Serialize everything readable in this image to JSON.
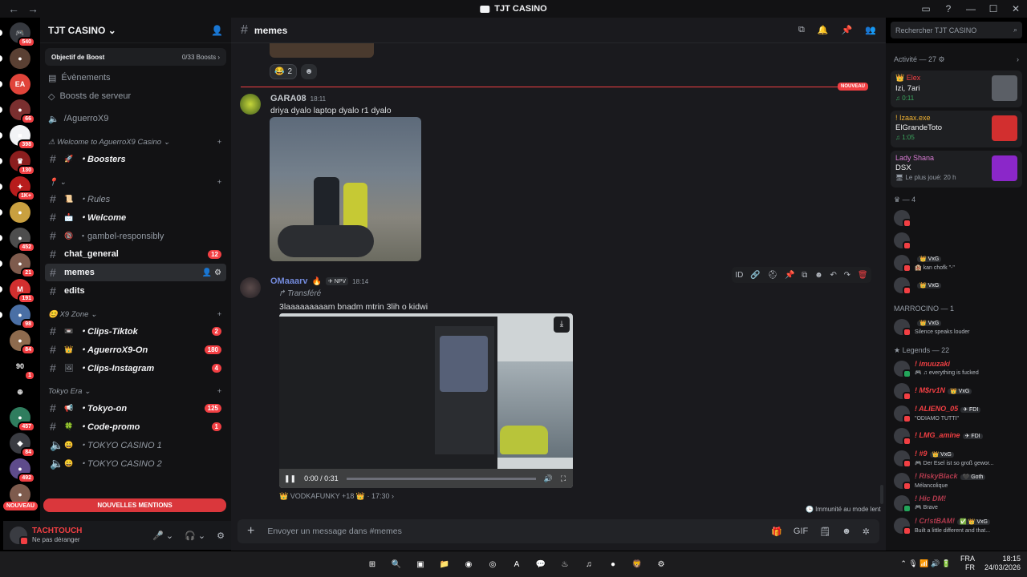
{
  "window": {
    "title": "TJT CASINO",
    "nav_back": "←",
    "nav_fwd": "→",
    "controls": [
      "▭",
      "?",
      "—",
      "☐",
      "✕"
    ]
  },
  "guilds": [
    {
      "label": "🎮",
      "badge": "540",
      "bg": "#36393f"
    },
    {
      "label": "●",
      "badge": "",
      "bg": "#5a4033"
    },
    {
      "label": "EA",
      "badge": "",
      "bg": "#e0443a"
    },
    {
      "label": "●",
      "badge": "66",
      "bg": "#7a2f2f"
    },
    {
      "label": "■",
      "badge": "398",
      "bg": "#f2f3f5"
    },
    {
      "label": "♛",
      "badge": "130",
      "bg": "#8b1e1e"
    },
    {
      "label": "✦",
      "badge": "1K+",
      "bg": "#b71c1c"
    },
    {
      "label": "●",
      "badge": "",
      "bg": "#c9a040"
    },
    {
      "label": "●",
      "badge": "452",
      "bg": "#4d4d4d"
    },
    {
      "label": "●",
      "badge": "21",
      "bg": "#7e5b4d"
    },
    {
      "label": "M",
      "badge": "191",
      "bg": "#d22f2f"
    },
    {
      "label": "●",
      "badge": "98",
      "bg": "#4a6fa5"
    },
    {
      "label": "●",
      "badge": "84",
      "bg": "#8e6b4e"
    },
    {
      "label": "90",
      "badge": "1",
      "bg": "#000000"
    },
    {
      "label": "⊕",
      "badge": "",
      "bg": "#000000"
    },
    {
      "label": "●",
      "badge": "457",
      "bg": "#2f7d5e"
    },
    {
      "label": "◆",
      "badge": "84",
      "bg": "#3a3c42"
    },
    {
      "label": "●",
      "badge": "492",
      "bg": "#5e4b8b"
    },
    {
      "label": "●",
      "badge": "",
      "bg": "#7e5b4d"
    }
  ],
  "guilds_new": "NOUVEAU",
  "server": {
    "name": "TJT CASINO",
    "chevron": "⌄",
    "add_icon": "👤",
    "boost_goal": "Objectif de Boost",
    "boost_count": "0/33 Boosts",
    "boost_arrow": "›",
    "events": "Évènements",
    "server_boosts": "Boosts de serveur",
    "voice_top": "/AguerroX9"
  },
  "categories": [
    {
      "title": "⚠ Welcome to AguerroX9 Casino ⌄",
      "channels": [
        {
          "emoji": "🚀",
          "name": "・Boosters",
          "style": "ital",
          "bold": true,
          "count": ""
        }
      ]
    },
    {
      "title": "📍 ⌄",
      "channels": [
        {
          "emoji": "📜",
          "name": "・Rules",
          "style": "ital",
          "bold": false,
          "count": ""
        },
        {
          "emoji": "📩",
          "name": "・Welcome",
          "style": "ital",
          "bold": true,
          "count": ""
        },
        {
          "emoji": "🔞",
          "name": "・gambel-responsibly",
          "style": "",
          "bold": false,
          "count": ""
        },
        {
          "emoji": "",
          "name": "chat_general",
          "style": "",
          "bold": true,
          "count": "12"
        },
        {
          "emoji": "",
          "name": "memes",
          "style": "",
          "bold": true,
          "count": "",
          "active": true
        },
        {
          "emoji": "",
          "name": "edits",
          "style": "",
          "bold": true,
          "count": ""
        }
      ]
    },
    {
      "title": "😊 X9 Zone ⌄",
      "channels": [
        {
          "emoji": "📼",
          "name": "・Clips-Tiktok",
          "style": "ital",
          "bold": true,
          "count": "2"
        },
        {
          "emoji": "👑",
          "name": "・AguerroX9-On",
          "style": "ital",
          "bold": true,
          "count": "180"
        },
        {
          "emoji": "🖼",
          "name": "・Clips-Instagram",
          "style": "ital",
          "bold": true,
          "count": "4"
        }
      ]
    },
    {
      "title": "Tokyo Era ⌄",
      "channels": [
        {
          "emoji": "📢",
          "name": "・Tokyo-on",
          "style": "ital",
          "bold": true,
          "count": "125"
        },
        {
          "emoji": "🍀",
          "name": "・Code-promo",
          "style": "ital",
          "bold": true,
          "count": "1"
        },
        {
          "emoji": "😀",
          "name": "・TOKYO CASINO 1",
          "style": "ital",
          "bold": false,
          "count": "",
          "voice": true
        },
        {
          "emoji": "😀",
          "name": "・TOKYO CASINO 2",
          "style": "ital",
          "bold": false,
          "count": "",
          "voice": true
        }
      ]
    }
  ],
  "mentions_bar": "NOUVELLES MENTIONS",
  "user": {
    "name": "TACHTOUCH",
    "status": "Ne pas déranger",
    "mic": "🎤 ⌄",
    "headset": "🎧 ⌄",
    "settings": "⚙"
  },
  "chat": {
    "channel": "memes",
    "search_placeholder": "Rechercher TJT CASINO",
    "header_icons": [
      "⧉",
      "🔔",
      "📌",
      "👥"
    ],
    "reaction1_emoji": "😂",
    "reaction1_count": "2",
    "reaction2": "☻",
    "new_label": "NOUVEAU",
    "msg1": {
      "author": "GARA08",
      "time": "18:11",
      "text": "driya dyalo laptop dyalo r1 dyalo",
      "author_color": "#c4c9ce"
    },
    "msg2": {
      "author": "OMaaarv",
      "badge1": "🔥",
      "badge2": "✈ NPV",
      "time": "18:14",
      "forwarded": "↱ Transféré",
      "text": "3laaaaaaaaam bnadm mtrin 3lih o kidwi",
      "author_color": "#7289da"
    },
    "video": {
      "time": "0:00 / 0:31",
      "progress": 0.0,
      "download": "⤓",
      "play": "❚❚",
      "volume": "🔊",
      "full": "⛶"
    },
    "reply_info": "👑 VODKAFUNKY +18 👑 · 17:30 ›",
    "tools": [
      "ID",
      "🔗",
      "⛑",
      "📌",
      "⧉",
      "☻",
      "↶",
      "↷",
      "🗑"
    ],
    "immunity": "🕒 Immunité au mode lent",
    "compose_placeholder": "Envoyer un message dans #memes",
    "compose_plus": "+",
    "compose_tools": [
      "🎁",
      "GIF",
      "🗒",
      "☻",
      "✲"
    ]
  },
  "members": {
    "activity_title": "Activité — 27 ⚙",
    "activity_arrow": "›",
    "activities": [
      {
        "user": "👑 Elex",
        "line2": "Izi, 7ari",
        "line3": "♫ 0:11",
        "color": "#f23f43",
        "thumb": "#5b5f66",
        "playing": true
      },
      {
        "user": "! Izaax.exe",
        "line2": "ElGrandeToto",
        "line3": "♫ 1:05",
        "color": "#f0b232",
        "thumb": "#d22f2f",
        "playing": true
      },
      {
        "user": "Lady Shana",
        "line2": "DSX",
        "line3": "🖥 Le plus joué: 20 h",
        "color": "#d87bd3",
        "thumb": "#8b27c9",
        "playing": false
      }
    ],
    "sec1": "♛ — 4",
    "sec1_members": [
      {
        "name": "",
        "status": "",
        "tag": "",
        "color": "#dbdee1"
      },
      {
        "name": "",
        "status": "",
        "tag": "",
        "color": "#dbdee1"
      },
      {
        "name": "",
        "status": "🏨 kan chofk \"-\"",
        "tag": "👑 VxG",
        "color": "#dbdee1"
      },
      {
        "name": "",
        "status": "",
        "tag": "👑 VxG",
        "color": "#dbdee1"
      }
    ],
    "sec2": "MARROCINO — 1",
    "sec2_members": [
      {
        "name": "",
        "status": "Silence speaks louder",
        "tag": "👑 VxG",
        "color": "#dbdee1"
      }
    ],
    "sec3": "★ Legends — 22",
    "sec3_members": [
      {
        "name": "! imuuzaki",
        "status": "🎮 ♫ everything is fucked",
        "tag": "",
        "color": "#f23f43",
        "on": true
      },
      {
        "name": "! M$rv1N",
        "status": "",
        "tag": "👑 VxG",
        "color": "#f23f43",
        "on": false
      },
      {
        "name": "! ALIENO_05",
        "status": "\"ODIAMO TUTTI\"",
        "tag": "✈ FDI",
        "color": "#f23f43",
        "on": false
      },
      {
        "name": "! LMG_amine",
        "status": "",
        "tag": "✈ FDI",
        "color": "#f23f43",
        "on": false
      },
      {
        "name": "! #9",
        "status": "🎮 Der Esel ist so groß gewor...",
        "tag": "👑 VxG",
        "color": "#f23f43",
        "on": false
      },
      {
        "name": "! RiskyBlack",
        "status": "Mélancolique",
        "tag": "🖤 Goth",
        "color": "#b03a4d",
        "on": false
      },
      {
        "name": "! Hic DM!",
        "status": "🎮 Brave",
        "tag": "",
        "color": "#b03a4d",
        "on": true
      },
      {
        "name": "! Cr!stBAM!",
        "status": "Built a little different and that...",
        "tag": "✅ 👑 VxG",
        "color": "#b03a4d",
        "on": false
      }
    ]
  },
  "taskbar": {
    "apps": [
      "⊞",
      "🔍",
      "▣",
      "📁",
      "◉",
      "◎",
      "A",
      "💬",
      "♨",
      "♫",
      "●",
      "🦁",
      "⚙"
    ],
    "lang1": "FRA",
    "lang2": "FR",
    "time": "18:15",
    "date": "24/03/2026",
    "tray_icons": "⌃ 🎙 📶 🔊 🔋"
  },
  "colors": {
    "accent": "#5865f2",
    "danger": "#f23f43",
    "online": "#23a55a"
  }
}
